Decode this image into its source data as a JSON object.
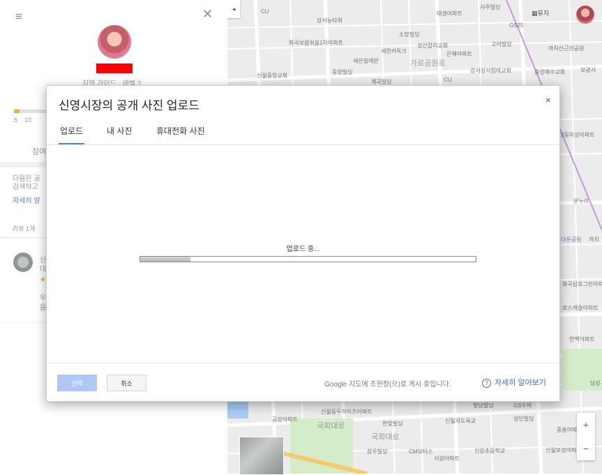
{
  "colors": {
    "accent": "#4285f4",
    "star": "#f4b400",
    "select_button": "#b0c8f4"
  },
  "side_panel": {
    "menu_icon": "hamburger-icon",
    "close_icon": "close-icon",
    "subtitle": "지역 가이드 · 레벨 2",
    "progress_ticks": [
      "5",
      "10"
    ],
    "tab_partial": "참여",
    "description_line1": "다음은 공",
    "description_line2": "검색하고 ",
    "more_link": "자세히 알",
    "reviews_label": "리뷰 1개",
    "review": {
      "name": "신",
      "subtitle": "대",
      "stars": "★",
      "text1": "우",
      "text2": "음"
    }
  },
  "map": {
    "collapse_arrow": "◂",
    "apps_label": "▦유지",
    "zoom_in": "+",
    "zoom_out": "−",
    "labels": [
      "CU",
      "강서뉴타워",
      "태경아파트",
      "서주빌딩",
      "GS25",
      "화곡보람쉬움1차아파트",
      "소망빌딩",
      "성산갈리교회",
      "새한카독크",
      "고려빌딩",
      "까치산근린공원",
      "은혜아파트",
      "세븐일레븐",
      "가로공원로",
      "동양빌딩",
      "신월중앙교회",
      "계곡빌딩",
      "CU",
      "강서성서침례교회",
      "중앙예수교회",
      "보광사",
      "2동미성아파트",
      "온누리",
      "다운공원",
      "까치",
      "화곡삼호그린아파트",
      "로스캐슬아파트",
      "한백아파트",
      "신월동두하이츠아파트",
      "공강아파트",
      "국회대로",
      "한빛빌딩",
      "신월자도육교",
      "성민빌딩",
      "중흥아파트",
      "국회대로",
      "삼우빌딩",
      "CM모터스",
      "서원아파트",
      "신강초등학교",
      "신월보성아파트",
      "남강",
      "GS수퍼",
      "형남빌딩"
    ]
  },
  "dialog": {
    "title": "신영시장의 공개 사진 업로드",
    "close_label": "×",
    "tabs": [
      {
        "label": "업로드",
        "active": true
      },
      {
        "label": "내 사진",
        "active": false
      },
      {
        "label": "휴대전화 사진",
        "active": false
      }
    ],
    "upload_status": "업로드 중...",
    "upload_progress_percent": 15,
    "select_button": "선택",
    "cancel_button": "취소",
    "footer_note": "Google 지도에 조현정(으)로 게시 중입니다.",
    "help_icon": "?",
    "help_link": "자세히 알아보기"
  }
}
